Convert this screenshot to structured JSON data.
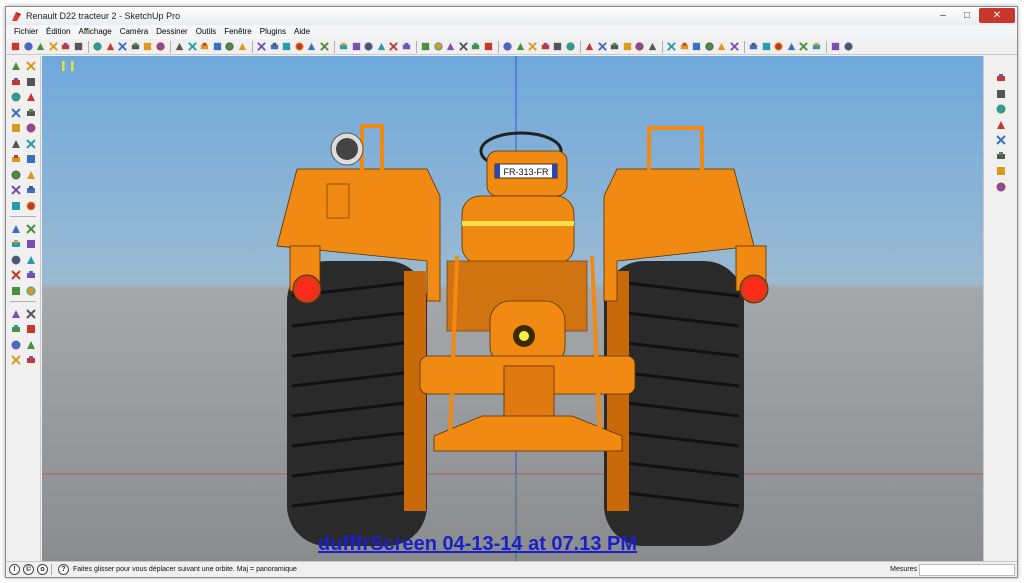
{
  "window": {
    "title": "Renault D22 tracteur 2 - SketchUp Pro",
    "controls": {
      "minimize": "–",
      "maximize": "□",
      "close": "✕"
    }
  },
  "menu": {
    "items": [
      "Fichier",
      "Édition",
      "Affichage",
      "Caméra",
      "Dessiner",
      "Outils",
      "Fenêtre",
      "Plugins",
      "Aide"
    ]
  },
  "toolbar": {
    "icons": [
      "select-icon",
      "pencil-icon",
      "rectangle-icon",
      "circle-icon",
      "arc-icon",
      "polygon-icon",
      "eraser-icon",
      "paint-bucket-icon",
      "push-pull-icon",
      "move-icon",
      "rotate-icon",
      "follow-me-icon",
      "scale-icon",
      "offset-icon",
      "tape-measure-icon",
      "dimension-icon",
      "protractor-icon",
      "text-icon",
      "axes-icon",
      "3d-text-icon",
      "orbit-icon",
      "pan-icon",
      "zoom-icon",
      "zoom-window-icon",
      "zoom-extents-icon",
      "previous-view-icon",
      "next-view-icon",
      "position-camera-icon",
      "walk-icon",
      "look-around-icon",
      "section-plane-icon",
      "get-models-icon",
      "share-model-icon",
      "share-component-icon",
      "iso-view-icon",
      "top-view-icon",
      "front-view-icon",
      "right-view-icon",
      "back-view-icon",
      "left-view-icon",
      "xray-icon",
      "back-edges-icon",
      "wireframe-icon",
      "hidden-line-icon",
      "shaded-icon",
      "shaded-textures-icon",
      "monochrome-icon",
      "section-fill-icon",
      "section-display-icon",
      "section-cut-icon",
      "add-location-icon",
      "toggle-terrain-icon",
      "photo-textures-icon",
      "warehouse-icon",
      "extension-icon",
      "sandbox-icon",
      "plugin-a-icon",
      "plugin-b-icon",
      "plugin-c-icon",
      "plugin-d-icon",
      "plugin-e-icon",
      "plugin-f-icon"
    ],
    "accent": "#c7372b"
  },
  "left_tools": {
    "icons": [
      "select-icon",
      "component-icon",
      "paint-bucket-icon",
      "eraser-icon",
      "rectangle-icon",
      "line-icon",
      "circle-icon",
      "arc-icon",
      "polygon-icon",
      "freehand-icon",
      "move-icon",
      "push-pull-icon",
      "rotate-icon",
      "follow-me-icon",
      "scale-icon",
      "offset-icon",
      "tape-measure-icon",
      "dimension-icon",
      "protractor-icon",
      "text-icon",
      "axes-icon",
      "3d-text-icon",
      "orbit-icon",
      "pan-icon",
      "zoom-icon",
      "zoom-window-icon",
      "previous-view-icon",
      "zoom-extents-icon",
      "position-camera-icon",
      "walk-icon",
      "footprint-icon",
      "look-around-icon",
      "section-plane-icon",
      "get-models-icon",
      "share-model-icon",
      "share-component-icon",
      "extension-icon",
      "sandbox-icon"
    ]
  },
  "right_tools": {
    "icons": [
      "smoove-icon",
      "stamp-icon",
      "drape-icon",
      "add-detail-icon",
      "flip-edge-icon",
      "from-contours-icon",
      "from-scratch-icon",
      "sandbox-grid-icon"
    ]
  },
  "viewport": {
    "sky_color": "#6fa9dc",
    "ground_color": "#8a8c8e",
    "model_color": "#f08a12",
    "tire_color": "#2a2a2a",
    "license_plate": "FR-313-FR",
    "watermark": "dufffrScreen 04-13-14 at 07.13 PM"
  },
  "status": {
    "hint": "Faites glisser pour vous déplacer suivant une orbite.  Maj = panoramique",
    "measure_label": "Mesures",
    "measure_value": ""
  }
}
